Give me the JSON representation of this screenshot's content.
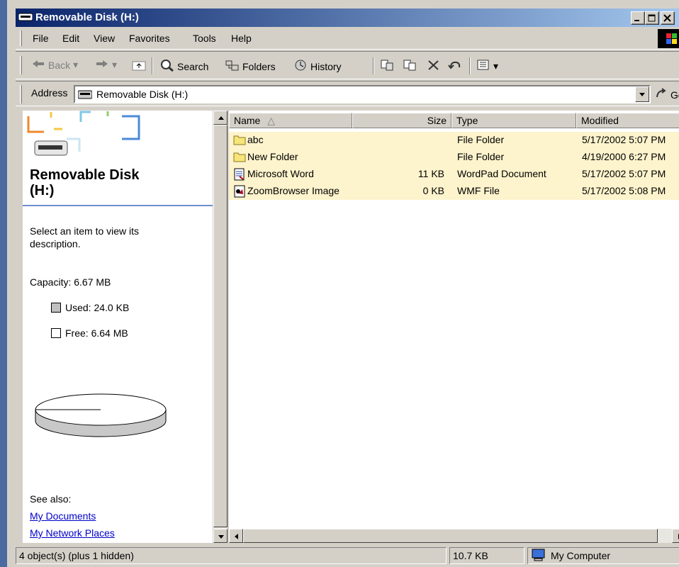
{
  "window": {
    "title": "Removable Disk (H:)"
  },
  "menu": {
    "file": "File",
    "edit": "Edit",
    "view": "View",
    "favorites": "Favorites",
    "tools": "Tools",
    "help": "Help"
  },
  "toolbar": {
    "back": "Back",
    "search": "Search",
    "folders": "Folders",
    "history": "History"
  },
  "address": {
    "label": "Address",
    "value": "Removable Disk (H:)",
    "go": "Go"
  },
  "left_pane": {
    "title_line1": "Removable Disk",
    "title_line2": "(H:)",
    "description": "Select an item to view its description.",
    "capacity": "Capacity: 6.67 MB",
    "used": "Used: 24.0 KB",
    "free": "Free: 6.64 MB",
    "used_fraction": 0.0035,
    "see_also": "See also:",
    "links": [
      "My Documents",
      "My Network Places"
    ]
  },
  "columns": {
    "name": "Name",
    "size": "Size",
    "type": "Type",
    "modified": "Modified"
  },
  "files": [
    {
      "name": "abc",
      "size": "",
      "type": "File Folder",
      "modified": "5/17/2002 5:07 PM",
      "icon": "folder-icon"
    },
    {
      "name": "New Folder",
      "size": "",
      "type": "File Folder",
      "modified": "4/19/2000 6:27 PM",
      "icon": "folder-icon"
    },
    {
      "name": "Microsoft Word",
      "size": "11 KB",
      "type": "WordPad Document",
      "modified": "5/17/2002 5:07 PM",
      "icon": "wordpad-document-icon"
    },
    {
      "name": "ZoomBrowser Image",
      "size": "0 KB",
      "type": "WMF File",
      "modified": "5/17/2002 5:08 PM",
      "icon": "wmf-file-icon"
    }
  ],
  "status": {
    "objects": "4 object(s) (plus 1 hidden)",
    "size": "10.7 KB",
    "zone": "My Computer"
  },
  "colors": {
    "title_start": "#0a246a",
    "title_end": "#a6caf0",
    "row_highlight": "#fdf3cc",
    "link": "#0000cc"
  }
}
